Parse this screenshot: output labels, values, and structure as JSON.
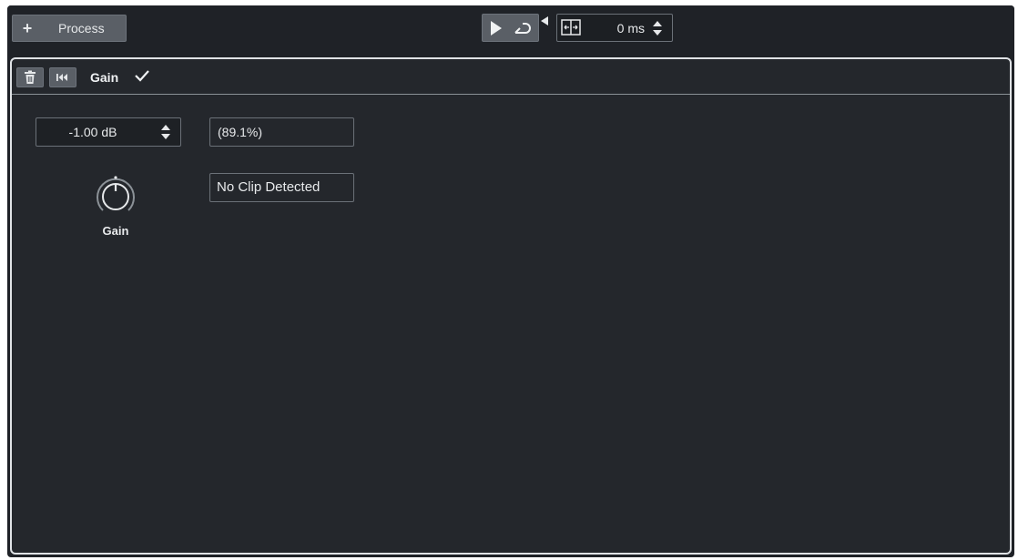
{
  "toolbar": {
    "process_plus": "+",
    "process_label": "Process",
    "preroll_value": "0 ms"
  },
  "module": {
    "name": "Gain",
    "gain_value": "-1.00 dB",
    "gain_percent": "(89.1%)",
    "clip_status": "No Clip Detected",
    "knob_label": "Gain"
  },
  "colors": {
    "background": "#1f2227",
    "button": "#5a5f66",
    "text": "#e8eaec"
  }
}
